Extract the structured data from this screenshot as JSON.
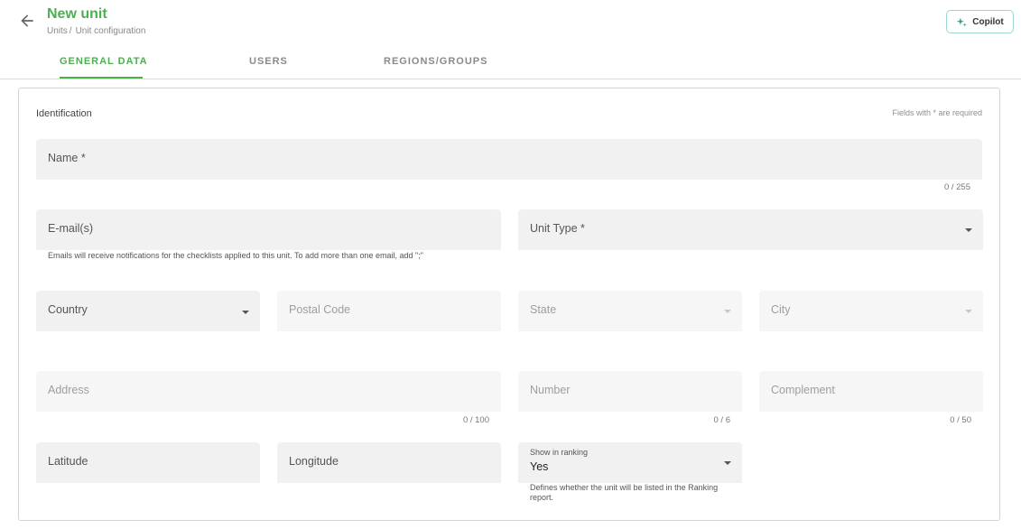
{
  "header": {
    "title": "New unit",
    "breadcrumb": [
      "Units",
      "Unit configuration"
    ],
    "breadcrumb_sep": "/",
    "copilot_label": "Copilot"
  },
  "tabs": [
    {
      "label": "GENERAL DATA",
      "active": true
    },
    {
      "label": "USERS",
      "active": false
    },
    {
      "label": "REGIONS/GROUPS",
      "active": false
    }
  ],
  "form": {
    "section_title": "Identification",
    "required_note": "Fields with * are required",
    "name": {
      "label": "Name *",
      "counter": "0 / 255"
    },
    "emails": {
      "label": "E-mail(s)",
      "hint": "Emails will receive notifications for the checklists applied to this unit. To add more than one email, add \";\""
    },
    "unit_type": {
      "label": "Unit Type *"
    },
    "country": {
      "label": "Country"
    },
    "postal_code": {
      "label": "Postal Code"
    },
    "state": {
      "label": "State"
    },
    "city": {
      "label": "City"
    },
    "address": {
      "label": "Address",
      "counter": "0 / 100"
    },
    "number": {
      "label": "Number",
      "counter": "0 / 6"
    },
    "complement": {
      "label": "Complement",
      "counter": "0 / 50"
    },
    "latitude": {
      "label": "Latitude"
    },
    "longitude": {
      "label": "Longitude"
    },
    "show_in_ranking": {
      "label": "Show in ranking",
      "value": "Yes",
      "hint": "Defines whether the unit will be listed in the Ranking report."
    }
  },
  "colors": {
    "accent": "#4caf50",
    "copilot_border": "#9ed6cf"
  }
}
